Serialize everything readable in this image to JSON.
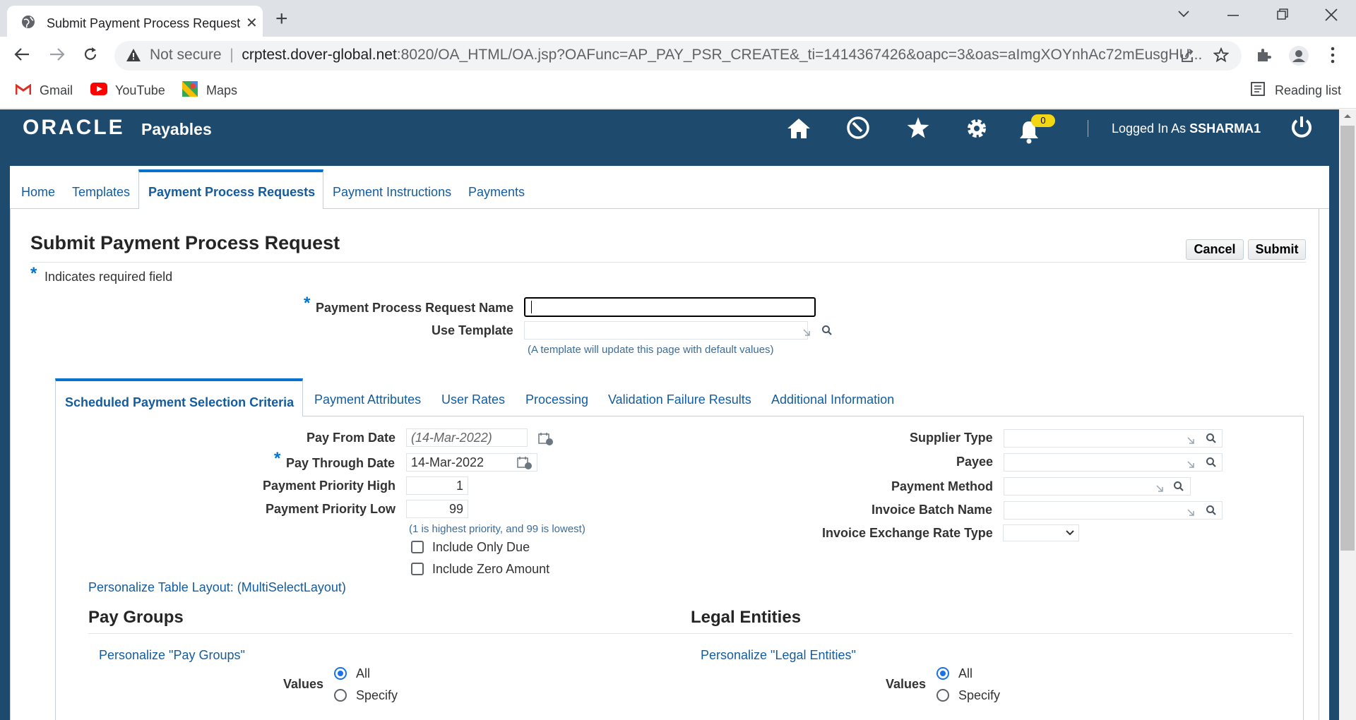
{
  "browser": {
    "tab_title": "Submit Payment Process Request",
    "close_glyph": "✕",
    "new_tab_glyph": "+",
    "url_security": "Not secure",
    "url_host": "crptest.dover-global.net",
    "url_rest": ":8020/OA_HTML/OA.jsp?OAFunc=AP_PAY_PSR_CREATE&_ti=1414367426&oapc=3&oas=aImgXOYnhAc72mEusgHU...",
    "bookmarks": [
      "Gmail",
      "YouTube",
      "Maps"
    ],
    "reading_list": "Reading list"
  },
  "header": {
    "logo": "ORACLE",
    "product": "Payables",
    "logged_in_prefix": "Logged In As",
    "username": "SSHARMA1",
    "notification_count": "0"
  },
  "top_tabs": {
    "home": "Home",
    "templates": "Templates",
    "payment_process_requests": "Payment Process Requests",
    "payment_instructions": "Payment Instructions",
    "payments": "Payments"
  },
  "page": {
    "title": "Submit Payment Process Request",
    "cancel": "Cancel",
    "submit": "Submit",
    "required_star": "*",
    "required_note": "Indicates required field",
    "ppr_name_label": "Payment Process Request Name",
    "ppr_name_value": "",
    "use_template_label": "Use Template",
    "use_template_value": "",
    "template_hint": "(A template will update this page with default values)"
  },
  "sub_tabs": {
    "scheduled": "Scheduled Payment Selection Criteria",
    "attributes": "Payment Attributes",
    "user_rates": "User Rates",
    "processing": "Processing",
    "validation": "Validation Failure Results",
    "additional": "Additional Information"
  },
  "criteria": {
    "pay_from_label": "Pay From Date",
    "pay_from_value": "(14-Mar-2022)",
    "pay_through_label": "Pay Through Date",
    "pay_through_value": "14-Mar-2022",
    "priority_high_label": "Payment Priority High",
    "priority_high_value": "1",
    "priority_low_label": "Payment Priority Low",
    "priority_low_value": "99",
    "priority_hint": "(1 is highest priority, and 99 is lowest)",
    "include_only_due": "Include Only Due",
    "include_zero_amount": "Include Zero Amount",
    "supplier_type_label": "Supplier Type",
    "payee_label": "Payee",
    "payment_method_label": "Payment Method",
    "invoice_batch_label": "Invoice Batch Name",
    "exchange_rate_label": "Invoice Exchange Rate Type",
    "personalize_table": "Personalize Table Layout: (MultiSelectLayout)"
  },
  "pay_groups": {
    "title": "Pay Groups",
    "personalize": "Personalize \"Pay Groups\"",
    "values_label": "Values",
    "all": "All",
    "specify": "Specify"
  },
  "legal_entities": {
    "title": "Legal Entities",
    "personalize": "Personalize \"Legal Entities\"",
    "values_label": "Values",
    "all": "All",
    "specify": "Specify"
  }
}
